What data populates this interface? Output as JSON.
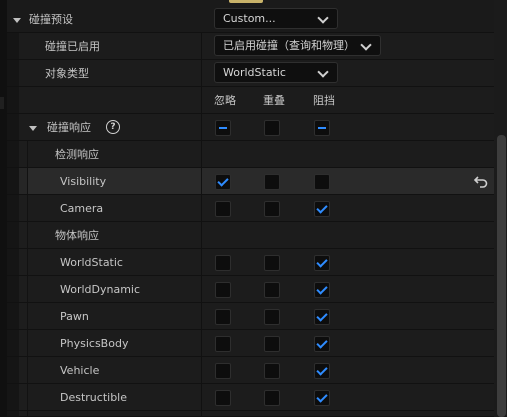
{
  "preset_row": {
    "label": "碰撞预设",
    "value": "Custom..."
  },
  "enabled_row": {
    "label": "碰撞已启用",
    "value": "已启用碰撞（查询和物理）"
  },
  "object_type_row": {
    "label": "对象类型",
    "value": "WorldStatic"
  },
  "columns": {
    "ignore": "忽略",
    "overlap": "重叠",
    "block": "阻挡"
  },
  "responses_row": {
    "label": "碰撞响应",
    "help_icon": "question-circle-icon",
    "state": {
      "ignore": "mixed",
      "overlap": "unchecked",
      "block": "mixed"
    }
  },
  "trace_header": {
    "label": "检测响应"
  },
  "object_header": {
    "label": "物体响应"
  },
  "channels": [
    {
      "label": "Visibility",
      "state": "ignore",
      "highlighted": true,
      "reset_icon": "reset-arrow-icon"
    },
    {
      "label": "Camera",
      "state": "block"
    },
    {
      "label": "WorldStatic",
      "state": "block"
    },
    {
      "label": "WorldDynamic",
      "state": "block"
    },
    {
      "label": "Pawn",
      "state": "block"
    },
    {
      "label": "PhysicsBody",
      "state": "block"
    },
    {
      "label": "Vehicle",
      "state": "block"
    },
    {
      "label": "Destructible",
      "state": "block"
    }
  ],
  "colors": {
    "accent": "#2f8cff",
    "background": "#1c1c1c",
    "highlight": "#2a2a2a"
  }
}
